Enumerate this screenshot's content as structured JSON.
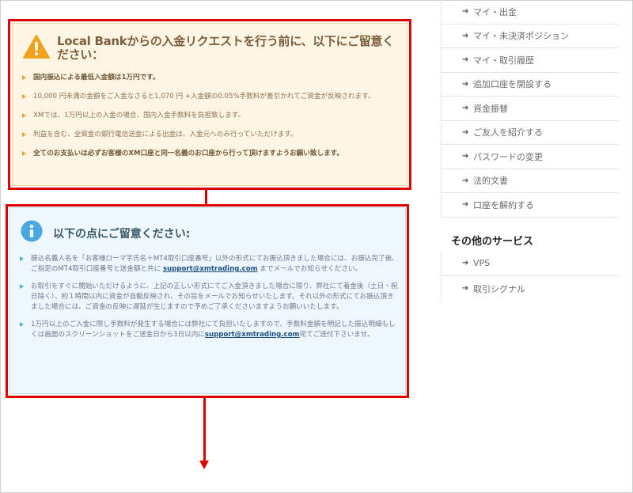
{
  "warning": {
    "title": "Local Bankからの入金リクエストを行う前に、以下にご留意ください：",
    "items": [
      {
        "text": "国内振込による最低入金額は1万円です。",
        "bold": true
      },
      {
        "text": "10,000 円未満の金額をご入金なさると1,070 円 +入金額の0.05%手数料が差引かれてご資金が反映されます。",
        "bold": false
      },
      {
        "text": "XMでは、1万円以上の入金の場合、国内入金手数料を負担致します。",
        "bold": false
      },
      {
        "text": "利益を含む、全資金の銀行電信送金による出金は、入金元へのみ行っていただけます。",
        "bold": false
      },
      {
        "text": "全てのお支払いは必ずお客様のXM口座と同一名義のお口座から行って頂けますようお願い致します。",
        "bold": true
      }
    ]
  },
  "info": {
    "title": "以下の点にご留意ください:",
    "items": [
      {
        "before": "振込名義人名を「お客様ローマ字氏名＋MT4取引口座番号」以外の形式にてお振込頂きました場合には、お振込完了後、ご指定のMT4取引口座番号と送金額と共に ",
        "link": "support@xmtrading.com",
        "after": " までメールでお知らせください。"
      },
      {
        "before": "お取引をすぐに開始いただけるように、上記の正しい形式にてご入金頂きました場合に限り、弊社にて着金後（土日・祝日除く）、約１時間以内に資金が自動反映され、その旨をメールでお知らせいたします。それ以外の形式にてお振込頂きました場合には、ご資金の反映に遅延が生じますので予めご了承くださいますようお願いいたします。",
        "link": "",
        "after": ""
      },
      {
        "before": "1万円以上のご入金に際し手数料が発生する場合には弊社にて負担いたしますので、手数料金額を明記した振込明細もしくは画面のスクリーンショットをご送金日から3日以内に",
        "link": "support@xmtrading.com",
        "after": "宛てご送付下さいませ。"
      }
    ]
  },
  "sidebar": {
    "menu": [
      "マイ・出金",
      "マイ・未決済ポジション",
      "マイ・取引履歴",
      "追加口座を開設する",
      "資金振替",
      "ご友人を紹介する",
      "パスワードの変更",
      "法的文書",
      "口座を解約する"
    ],
    "other_heading": "その他のサービス",
    "other_menu": [
      "VPS",
      "取引シグナル"
    ]
  },
  "colors": {
    "annotation_red": "#e00000",
    "warning_bg": "#fef5e4",
    "info_bg": "#edf7fd",
    "link": "#1d4f80"
  },
  "icons": {
    "warning": "warning-triangle-icon",
    "info": "info-circle-icon",
    "menu_arrow": "arrow-right-icon"
  }
}
